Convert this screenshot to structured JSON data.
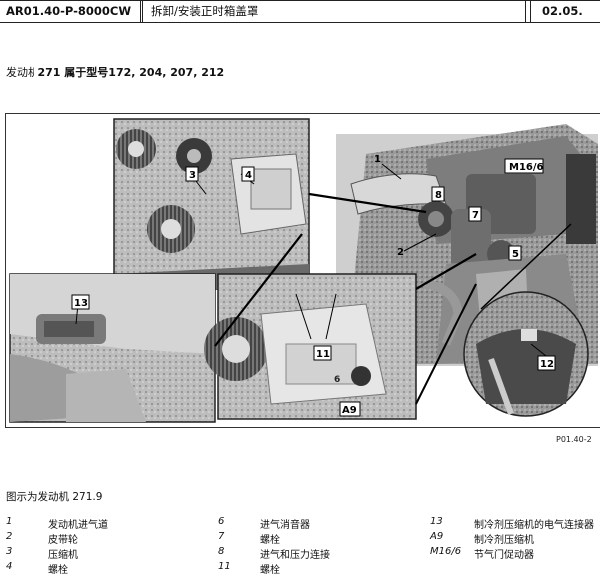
{
  "header": {
    "doc_code": "AR01.40-P-8000CW",
    "title": "拆卸/安装正时箱盖罩",
    "date": "02.05."
  },
  "engine": {
    "label": "发动机",
    "line": "271 属于型号172, 204, 207, 212"
  },
  "figure": {
    "code": "P01.40-2",
    "callouts": [
      "1",
      "2",
      "3",
      "4",
      "5",
      "6",
      "7",
      "8",
      "11",
      "12",
      "13",
      "A9",
      "M16/6"
    ]
  },
  "caption": "图示为发动机 271.9",
  "legend": [
    {
      "num": "1",
      "text": "发动机进气道"
    },
    {
      "num": "2",
      "text": "皮带轮"
    },
    {
      "num": "3",
      "text": "压缩机"
    },
    {
      "num": "4",
      "text": "螺栓"
    },
    {
      "num": "6",
      "text": "进气消音器"
    },
    {
      "num": "7",
      "text": "螺栓"
    },
    {
      "num": "8",
      "text": "进气和压力连接"
    },
    {
      "num": "11",
      "text": "螺栓"
    },
    {
      "num": "13",
      "text": "制冷剂压缩机的电气连接器"
    },
    {
      "num": "A9",
      "text": "制冷剂压缩机"
    },
    {
      "num": "M16/6",
      "text": "节气门促动器"
    }
  ]
}
